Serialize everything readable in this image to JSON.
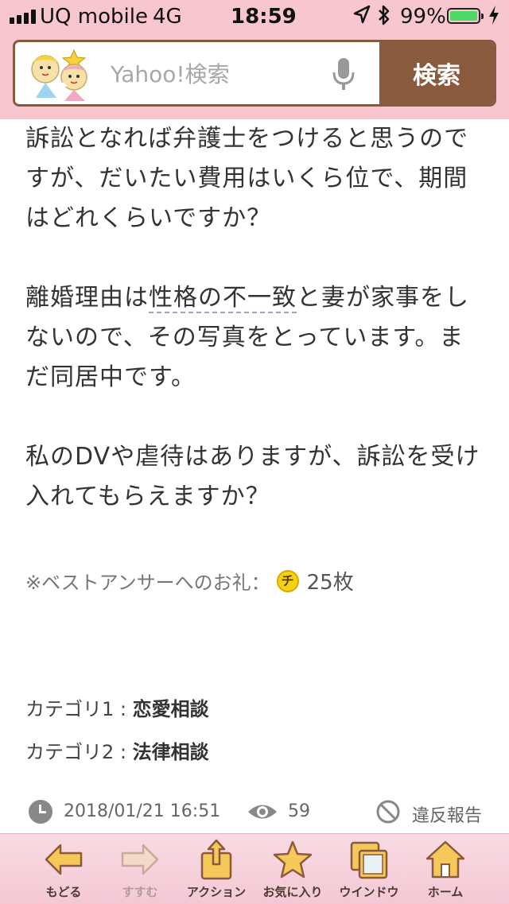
{
  "status_bar": {
    "carrier": "UQ mobile",
    "network": "4G",
    "time": "18:59",
    "battery_percent": "99%",
    "battery_level": 0.99,
    "icons": [
      "signal-icon",
      "location-icon",
      "bluetooth-icon",
      "battery-icon",
      "charging-icon"
    ]
  },
  "search": {
    "placeholder": "Yahoo!検索",
    "button_label": "検索",
    "icons": [
      "kiki-lala-mascot",
      "microphone-icon"
    ]
  },
  "question": {
    "paragraphs": [
      {
        "text_before": "訴訟となれば弁護士をつけると思うのですが、だいたい費用はいくら位で、期間はどれくらいですか？",
        "linked": "",
        "text_after": ""
      },
      {
        "text_before": "離婚理由は",
        "linked": "性格の不一致",
        "text_after": "と妻が家事をしないので、その写真をとっています。まだ同居中です。"
      },
      {
        "text_before": "私のDVや虐待はありますが、訴訟を受け入れてもらえますか？",
        "linked": "",
        "text_after": ""
      }
    ],
    "reward_label": "※ベストアンサーへのお礼：",
    "reward_coin": "チ",
    "reward_count": "25枚",
    "categories": [
      {
        "label": "カテゴリ1 : ",
        "value": "恋愛相談"
      },
      {
        "label": "カテゴリ2 : ",
        "value": "法律相談"
      }
    ],
    "posted_at": "2018/01/21 16:51",
    "views": "59",
    "report_label": "違反報告"
  },
  "toolbar": {
    "items": [
      {
        "label": "もどる",
        "icon": "back-arrow-icon",
        "enabled": true
      },
      {
        "label": "すすむ",
        "icon": "forward-arrow-icon",
        "enabled": false
      },
      {
        "label": "アクション",
        "icon": "share-icon",
        "enabled": true
      },
      {
        "label": "お気に入り",
        "icon": "star-icon",
        "enabled": true
      },
      {
        "label": "ウインドウ",
        "icon": "windows-icon",
        "enabled": true
      },
      {
        "label": "ホーム",
        "icon": "home-icon",
        "enabled": true
      }
    ]
  },
  "colors": {
    "header_pink": "#f7c6cf",
    "brand_brown": "#8a5a3e",
    "battery_green": "#4cd964",
    "coin_yellow": "#f5d312"
  }
}
